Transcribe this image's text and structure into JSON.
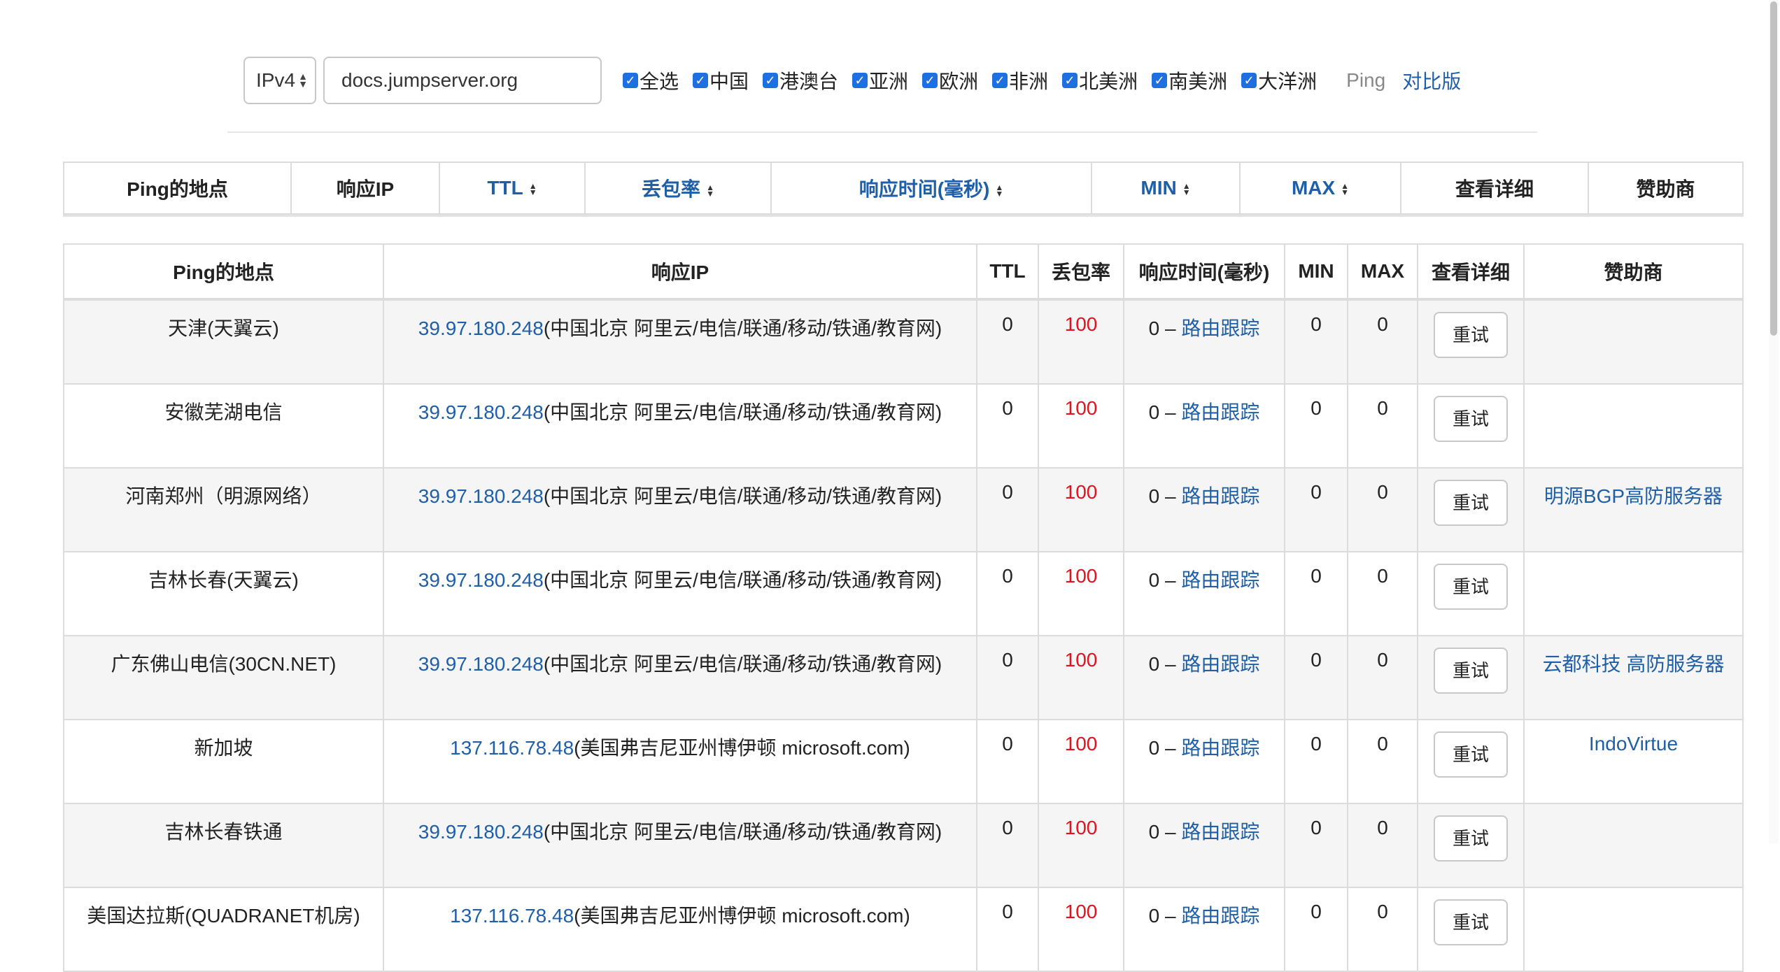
{
  "toolbar": {
    "ip_version": "IPv4",
    "domain": "docs.jumpserver.org",
    "checkboxes": [
      {
        "label": "全选",
        "checked": true
      },
      {
        "label": "中国",
        "checked": true
      },
      {
        "label": "港澳台",
        "checked": true
      },
      {
        "label": "亚洲",
        "checked": true
      },
      {
        "label": "欧洲",
        "checked": true
      },
      {
        "label": "非洲",
        "checked": true
      },
      {
        "label": "北美洲",
        "checked": true
      },
      {
        "label": "南美洲",
        "checked": true
      },
      {
        "label": "大洋洲",
        "checked": true
      }
    ],
    "ping_label": "Ping",
    "compare_link": "对比版"
  },
  "sticky_header": {
    "columns": [
      "Ping的地点",
      "响应IP",
      "TTL",
      "丢包率",
      "响应时间(毫秒)",
      "MIN",
      "MAX",
      "查看详细",
      "赞助商"
    ]
  },
  "table": {
    "columns": [
      "Ping的地点",
      "响应IP",
      "TTL",
      "丢包率",
      "响应时间(毫秒)",
      "MIN",
      "MAX",
      "查看详细",
      "赞助商"
    ],
    "trace_label": "路由跟踪",
    "retry_label": "重试",
    "rows": [
      {
        "location": "天津(天翼云)",
        "ip": "39.97.180.248",
        "ip_info": "(中国北京 阿里云/电信/联通/移动/铁通/教育网)",
        "ttl": "0",
        "loss": "100",
        "time": "0 –",
        "min": "0",
        "max": "0",
        "sponsor": ""
      },
      {
        "location": "安徽芜湖电信",
        "ip": "39.97.180.248",
        "ip_info": "(中国北京 阿里云/电信/联通/移动/铁通/教育网)",
        "ttl": "0",
        "loss": "100",
        "time": "0 –",
        "min": "0",
        "max": "0",
        "sponsor": ""
      },
      {
        "location": "河南郑州（明源网络）",
        "ip": "39.97.180.248",
        "ip_info": "(中国北京 阿里云/电信/联通/移动/铁通/教育网)",
        "ttl": "0",
        "loss": "100",
        "time": "0 –",
        "min": "0",
        "max": "0",
        "sponsor": "明源BGP高防服务器"
      },
      {
        "location": "吉林长春(天翼云)",
        "ip": "39.97.180.248",
        "ip_info": "(中国北京 阿里云/电信/联通/移动/铁通/教育网)",
        "ttl": "0",
        "loss": "100",
        "time": "0 –",
        "min": "0",
        "max": "0",
        "sponsor": ""
      },
      {
        "location": "广东佛山电信(30CN.NET)",
        "ip": "39.97.180.248",
        "ip_info": "(中国北京 阿里云/电信/联通/移动/铁通/教育网)",
        "ttl": "0",
        "loss": "100",
        "time": "0 –",
        "min": "0",
        "max": "0",
        "sponsor": "云都科技 高防服务器"
      },
      {
        "location": "新加坡",
        "ip": "137.116.78.48",
        "ip_info": "(美国弗吉尼亚州博伊顿 microsoft.com)",
        "ttl": "0",
        "loss": "100",
        "time": "0 –",
        "min": "0",
        "max": "0",
        "sponsor": "IndoVirtue"
      },
      {
        "location": "吉林长春铁通",
        "ip": "39.97.180.248",
        "ip_info": "(中国北京 阿里云/电信/联通/移动/铁通/教育网)",
        "ttl": "0",
        "loss": "100",
        "time": "0 –",
        "min": "0",
        "max": "0",
        "sponsor": ""
      },
      {
        "location": "美国达拉斯(QUADRANET机房)",
        "ip": "137.116.78.48",
        "ip_info": "(美国弗吉尼亚州博伊顿 microsoft.com)",
        "ttl": "0",
        "loss": "100",
        "time": "0 –",
        "min": "0",
        "max": "0",
        "sponsor": ""
      }
    ]
  }
}
